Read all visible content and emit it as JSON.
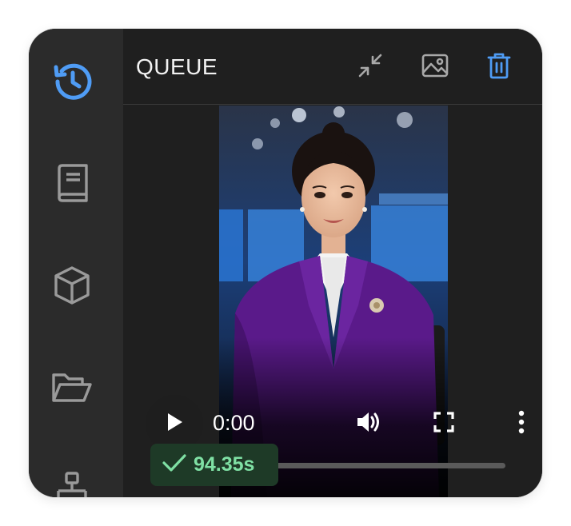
{
  "header": {
    "title": "QUEUE"
  },
  "sidebar": {
    "items": [
      {
        "name": "history",
        "icon": "history-icon",
        "active": true
      },
      {
        "name": "library",
        "icon": "book-icon",
        "active": false
      },
      {
        "name": "models",
        "icon": "cube-icon",
        "active": false
      },
      {
        "name": "files",
        "icon": "folder-open-icon",
        "active": false
      },
      {
        "name": "workflow",
        "icon": "sitemap-icon",
        "active": false
      }
    ]
  },
  "toolbar": {
    "buttons": [
      {
        "name": "collapse",
        "icon": "collapse-arrows-icon"
      },
      {
        "name": "image",
        "icon": "image-icon"
      },
      {
        "name": "delete",
        "icon": "trash-icon"
      }
    ]
  },
  "video": {
    "current_time": "0:00",
    "progress": 0
  },
  "status": {
    "duration": "94.35s",
    "icon": "check-icon"
  },
  "colors": {
    "accent": "#4f9cf5",
    "badge_bg": "#1e3a27",
    "badge_text": "#7fe0a4",
    "sidebar_bg": "#2b2b2b",
    "main_bg": "#1f1f1f"
  }
}
